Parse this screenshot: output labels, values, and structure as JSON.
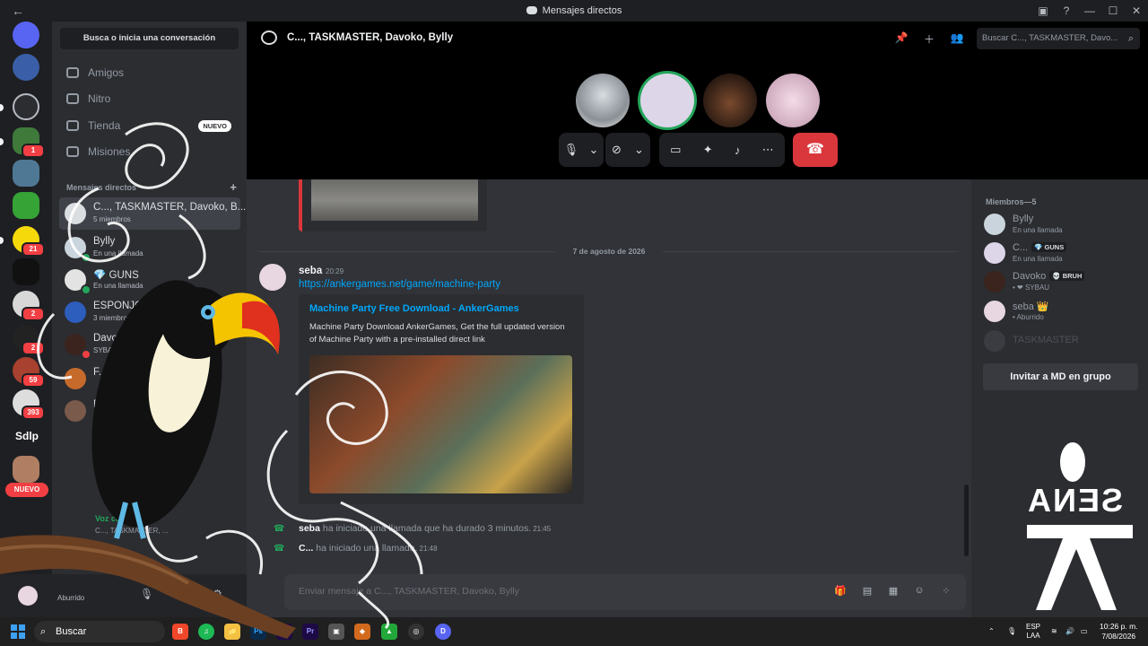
{
  "window": {
    "title": "Mensajes directos",
    "back": "←",
    "controls": [
      "▣",
      "?",
      "—",
      "☐",
      "✕"
    ]
  },
  "rail": {
    "home_icon": "discord-logo-icon",
    "badges": [
      "1",
      "21",
      "2",
      "2",
      "59",
      "393"
    ],
    "text_server": "Sdlp",
    "new_label": "NUEVO"
  },
  "sidebar": {
    "search": "Busca o inicia una conversación",
    "nav": [
      {
        "label": "Amigos"
      },
      {
        "label": "Nitro"
      },
      {
        "label": "Tienda",
        "badge": "NUEVO"
      },
      {
        "label": "Misiones"
      }
    ],
    "dm_header": "Mensajes directos",
    "dm_add": "+",
    "dms": [
      {
        "name": "C..., TASKMASTER, Davoko, B...",
        "sub": "5 miembros",
        "active": true
      },
      {
        "name": "Bylly",
        "sub": "En una llamada"
      },
      {
        "name": "💎 GUNS",
        "sub": "En una llamada"
      },
      {
        "name": "ESPONJOSEO",
        "sub": "3 miembros"
      },
      {
        "name": "Davoko",
        "sub": "SYBAU"
      },
      {
        "name": "F...",
        "sub": ""
      },
      {
        "name": "Re...",
        "sub": ""
      }
    ],
    "voice": {
      "status": "Voz co...",
      "channel": "C..., TASKMASTER, ..."
    },
    "user": {
      "status": "Aburrido"
    }
  },
  "header": {
    "title": "C..., TASKMASTER, Davoko, Bylly",
    "search_placeholder": "Buscar C..., TASKMASTER, Davo..."
  },
  "call": {
    "participants": [
      "Bylly",
      "C...",
      "Davoko",
      "seba"
    ]
  },
  "chat": {
    "date": "7 de agosto de 2026",
    "message": {
      "author": "seba",
      "time": "20:29",
      "link": "https://ankergames.net/game/machine-party",
      "embed_title": "Machine Party Free Download - AnkerGames",
      "embed_desc": "Machine Party Download AnkerGames, Get the full updated version of Machine Party with a pre-installed direct link"
    },
    "system": [
      {
        "author": "seba",
        "text": "ha iniciado una llamada que ha durado 3 minutos.",
        "time": "21:45"
      },
      {
        "author": "C...",
        "text": "ha iniciado una llamada.",
        "time": "21:48"
      }
    ],
    "composer_placeholder": "Enviar mensaje a C..., TASKMASTER, Davoko, Bylly"
  },
  "members": {
    "header": "Miembros—5",
    "list": [
      {
        "name": "Bylly",
        "tag": "",
        "sub": "En una llamada"
      },
      {
        "name": "C...",
        "tag": "💎 GUNS",
        "sub": "En una llamada"
      },
      {
        "name": "Davoko",
        "tag": "💀 BRUH",
        "sub": "• ❤ SYBAU"
      },
      {
        "name": "seba 👑",
        "tag": "",
        "sub": "• Aburrido"
      },
      {
        "name": "TASKMASTER",
        "tag": "",
        "sub": ""
      }
    ],
    "invite": "Invitar a MD en grupo"
  },
  "taskbar": {
    "search": "Buscar",
    "apps": [
      "B",
      "♫",
      "📁",
      "Ps",
      "Ae",
      "Pr",
      "▣",
      "◆",
      "▲",
      "◎",
      "D"
    ],
    "lang": "ESP",
    "lang2": "LAA",
    "time": "10:26 p. m.",
    "date": "7/08/2026"
  },
  "watermark": {
    "text": "SENA"
  }
}
